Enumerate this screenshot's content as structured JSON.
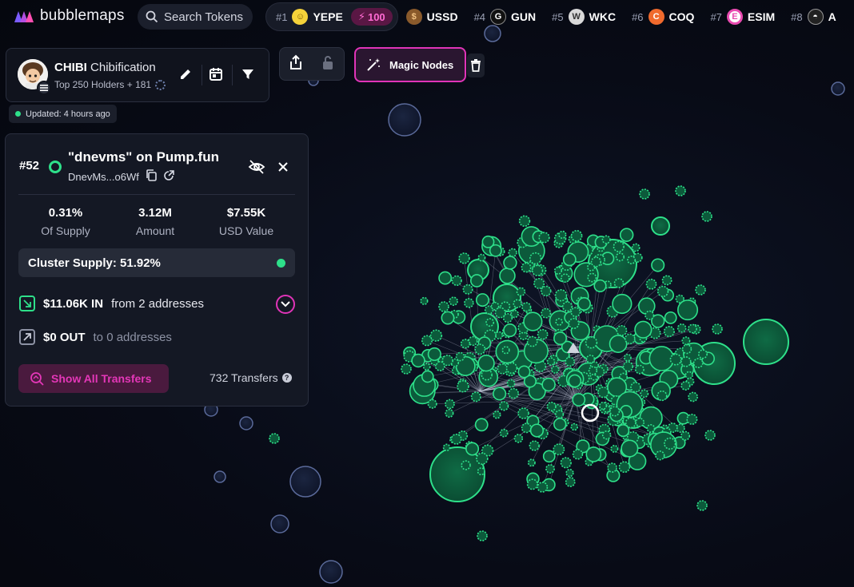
{
  "app": {
    "brand": "bubblemaps",
    "search_placeholder": "Search Tokens"
  },
  "ranking": [
    {
      "rank": "#1",
      "symbol": "YEPE",
      "score": "100",
      "coin_color": "#f5d23a",
      "icon": "yepe-coin-icon"
    },
    {
      "rank": "",
      "symbol": "USSD",
      "coin_color": "#8a5a2b",
      "icon": "ussd-coin-icon"
    },
    {
      "rank": "#4",
      "symbol": "GUN",
      "coin_color": "#111111",
      "icon": "gun-coin-icon"
    },
    {
      "rank": "#5",
      "symbol": "WKC",
      "coin_color": "#d9d9d9",
      "icon": "wkc-coin-icon"
    },
    {
      "rank": "#6",
      "symbol": "COQ",
      "coin_color": "#f06a2d",
      "icon": "coq-coin-icon"
    },
    {
      "rank": "#7",
      "symbol": "ESIM",
      "coin_color": "#e84bb0",
      "icon": "esim-coin-icon"
    },
    {
      "rank": "#8",
      "symbol": "A",
      "coin_color": "#222222",
      "icon": "next-coin-icon"
    }
  ],
  "token": {
    "symbol": "CHIBI",
    "name": "Chibification",
    "holders": "Top 250 Holders + 181",
    "updated": "Updated: 4 hours ago"
  },
  "toolbar": {
    "magic_nodes": "Magic Nodes"
  },
  "wallet": {
    "rank": "#52",
    "title": "\"dnevms\" on Pump.fun",
    "address": "DnevMs...o6Wf",
    "stats": [
      {
        "value": "0.31%",
        "label": "Of Supply"
      },
      {
        "value": "3.12M",
        "label": "Amount"
      },
      {
        "value": "$7.55K",
        "label": "USD Value"
      }
    ],
    "cluster_supply": "Cluster Supply: 51.92%",
    "in_amount": "$11.06K IN",
    "in_text": "from 2 addresses",
    "out_amount": "$0 OUT",
    "out_text": "to 0 addresses",
    "show_all": "Show All Transfers",
    "transfers": "732 Transfers"
  },
  "colors": {
    "accent": "#e034b8",
    "bubble_green": "#2ee08a",
    "bubble_blue": "#5a6a9a"
  }
}
